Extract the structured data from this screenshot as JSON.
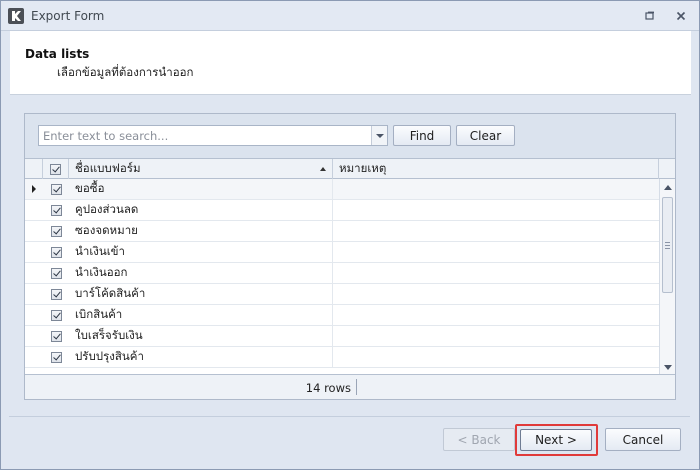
{
  "window": {
    "title": "Export Form",
    "controls": {
      "restore_icon": "restore-icon",
      "close_icon": "close-icon"
    }
  },
  "header": {
    "title": "Data lists",
    "subtitle": "เลือกข้อมูลที่ต้องการนำออก"
  },
  "search": {
    "placeholder": "Enter text to search...",
    "value": "",
    "find_label": "Find",
    "clear_label": "Clear"
  },
  "grid": {
    "columns": [
      "ชื่อแบบฟอร์ม",
      "หมายเหตุ"
    ],
    "sorted_column": "ชื่อแบบฟอร์ม",
    "sort_direction": "ascending",
    "rows": [
      {
        "name": "ขอซื้อ",
        "note": "",
        "checked": true,
        "selected": true
      },
      {
        "name": "คูปองส่วนลด",
        "note": "",
        "checked": true,
        "selected": false
      },
      {
        "name": "ซองจดหมาย",
        "note": "",
        "checked": true,
        "selected": false
      },
      {
        "name": "นำเงินเข้า",
        "note": "",
        "checked": true,
        "selected": false
      },
      {
        "name": "นำเงินออก",
        "note": "",
        "checked": true,
        "selected": false
      },
      {
        "name": "บาร์โค้ดสินค้า",
        "note": "",
        "checked": true,
        "selected": false
      },
      {
        "name": "เบิกสินค้า",
        "note": "",
        "checked": true,
        "selected": false
      },
      {
        "name": "ใบเสร็จรับเงิน",
        "note": "",
        "checked": true,
        "selected": false
      },
      {
        "name": "ปรับปรุงสินค้า",
        "note": "",
        "checked": true,
        "selected": false
      }
    ],
    "footer_count": "14 rows"
  },
  "buttons": {
    "back_label": "< Back",
    "next_label": "Next >",
    "cancel_label": "Cancel"
  },
  "colors": {
    "highlight": "#e03a3a",
    "window_bg": "#dfe6f1"
  }
}
